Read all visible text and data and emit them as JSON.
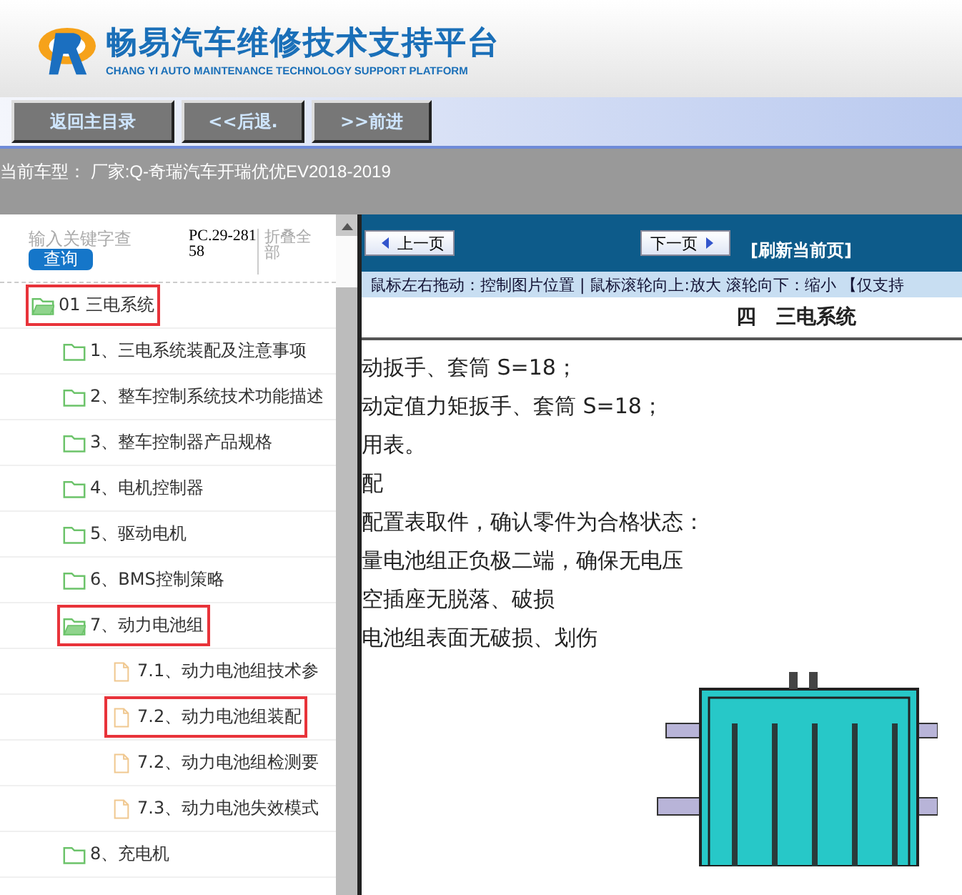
{
  "header": {
    "title": "畅易汽车维修技术支持平台",
    "subtitle": "CHANG YI AUTO MAINTENANCE TECHNOLOGY SUPPORT PLATFORM"
  },
  "toolbar": {
    "buttons": [
      "返回主目录",
      "<<后退.",
      ">>前进"
    ]
  },
  "current_model": "当前车型： 厂家:Q-奇瑞汽车开瑞优优EV2018-2019",
  "sidebar": {
    "search": {
      "placeholder": "输入关键字查"
    },
    "search_button": "查询",
    "code": "PC.29-28158",
    "collapse_all": "折叠全部",
    "tree": [
      {
        "label": "01 三电系统",
        "kind": "folder",
        "expanded": true,
        "highlighted": true,
        "children": [
          {
            "label": "1、三电系统装配及注意事项",
            "kind": "folder",
            "expanded": false,
            "highlighted": false
          },
          {
            "label": "2、整车控制系统技术功能描述",
            "kind": "folder",
            "expanded": false,
            "highlighted": false
          },
          {
            "label": "3、整车控制器产品规格",
            "kind": "folder",
            "expanded": false,
            "highlighted": false
          },
          {
            "label": "4、电机控制器",
            "kind": "folder",
            "expanded": false,
            "highlighted": false
          },
          {
            "label": "5、驱动电机",
            "kind": "folder",
            "expanded": false,
            "highlighted": false
          },
          {
            "label": "6、BMS控制策略",
            "kind": "folder",
            "expanded": false,
            "highlighted": false
          },
          {
            "label": "7、动力电池组",
            "kind": "folder",
            "expanded": true,
            "highlighted": true,
            "children": [
              {
                "label": "7.1、动力电池组技术参",
                "kind": "document",
                "highlighted": false
              },
              {
                "label": "7.2、动力电池组装配",
                "kind": "document",
                "highlighted": true
              },
              {
                "label": "7.2、动力电池组检测要",
                "kind": "document",
                "highlighted": false
              },
              {
                "label": "7.3、动力电池失效模式",
                "kind": "document",
                "highlighted": false
              }
            ]
          },
          {
            "label": "8、充电机",
            "kind": "folder",
            "expanded": false,
            "highlighted": false
          }
        ]
      }
    ]
  },
  "viewer": {
    "prev_button": "上一页",
    "next_button": "下一页",
    "refresh": "[刷新当前页]",
    "hint": "鼠标左右拖动：控制图片位置 | 鼠标滚轮向上:放大  滚轮向下：缩小 【仅支持",
    "heading": "四　三电系统",
    "lines": [
      "动扳手、套筒 S=18；",
      "动定值力矩扳手、套筒 S=18；",
      "用表。",
      "配",
      "配置表取件，确认零件为合格状态：",
      "量电池组正负极二端，确保无电压",
      "空插座无脱落、破损",
      "电池组表面无破损、划伤"
    ]
  }
}
